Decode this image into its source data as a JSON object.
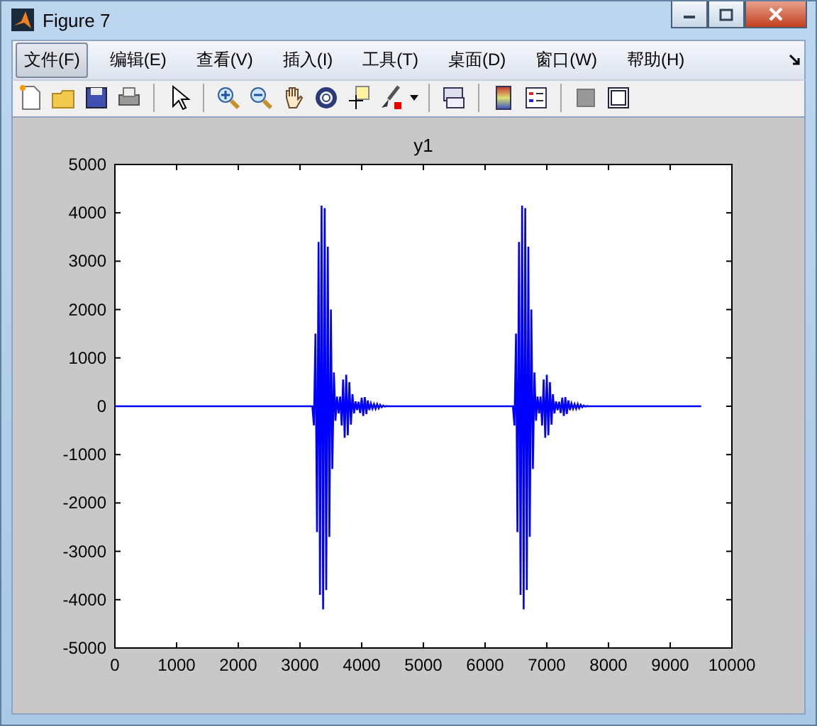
{
  "window": {
    "title": "Figure 7"
  },
  "menu": [
    {
      "label": "文件(F)",
      "selected": true
    },
    {
      "label": "编辑(E)",
      "selected": false
    },
    {
      "label": "查看(V)",
      "selected": false
    },
    {
      "label": "插入(I)",
      "selected": false
    },
    {
      "label": "工具(T)",
      "selected": false
    },
    {
      "label": "桌面(D)",
      "selected": false
    },
    {
      "label": "窗口(W)",
      "selected": false
    },
    {
      "label": "帮助(H)",
      "selected": false
    }
  ],
  "axes": {
    "chart_data": {
      "type": "line",
      "title": "y1",
      "xlim": [
        0,
        10000
      ],
      "ylim": [
        -5000,
        5000
      ],
      "xticks": [
        0,
        1000,
        2000,
        3000,
        4000,
        5000,
        6000,
        7000,
        8000,
        9000,
        10000
      ],
      "yticks": [
        -5000,
        -4000,
        -3000,
        -2000,
        -1000,
        0,
        1000,
        2000,
        3000,
        4000,
        5000
      ],
      "x": [
        0,
        3200,
        3225,
        3250,
        3275,
        3300,
        3325,
        3350,
        3375,
        3400,
        3425,
        3450,
        3475,
        3500,
        3525,
        3550,
        3575,
        3600,
        3625,
        3650,
        3675,
        3700,
        3725,
        3750,
        3775,
        3800,
        3825,
        3850,
        3875,
        3900,
        3925,
        3950,
        3975,
        4000,
        4025,
        4050,
        4075,
        4100,
        4125,
        4150,
        4175,
        4200,
        4225,
        4250,
        4275,
        4300,
        4325,
        4350,
        4375,
        4400,
        4425,
        6450,
        6475,
        6500,
        6525,
        6550,
        6575,
        6600,
        6625,
        6650,
        6675,
        6700,
        6725,
        6750,
        6775,
        6800,
        6825,
        6850,
        6875,
        6900,
        6925,
        6950,
        6975,
        7000,
        7025,
        7050,
        7075,
        7100,
        7125,
        7150,
        7175,
        7200,
        7225,
        7250,
        7275,
        7300,
        7325,
        7350,
        7375,
        7400,
        7425,
        7450,
        7475,
        7500,
        7525,
        7550,
        7575,
        7600,
        7625,
        7650,
        7675,
        9500
      ],
      "series": [
        {
          "color": "#0000ff",
          "values": [
            0,
            0,
            -400,
            1500,
            -2600,
            3400,
            -3900,
            4150,
            -4200,
            4100,
            -3800,
            3300,
            -2700,
            2000,
            -1300,
            700,
            -300,
            200,
            -150,
            200,
            -400,
            550,
            -650,
            650,
            -600,
            500,
            -380,
            250,
            -150,
            100,
            -80,
            90,
            -140,
            180,
            -200,
            190,
            -160,
            120,
            -80,
            60,
            -50,
            45,
            -50,
            45,
            -40,
            30,
            -20,
            15,
            -10,
            5,
            0,
            0,
            -400,
            1500,
            -2600,
            3400,
            -3900,
            4150,
            -4200,
            4100,
            -3800,
            3300,
            -2700,
            2000,
            -1300,
            700,
            -300,
            200,
            -150,
            200,
            -400,
            550,
            -650,
            650,
            -600,
            500,
            -380,
            250,
            -150,
            100,
            -80,
            90,
            -140,
            180,
            -200,
            190,
            -160,
            120,
            -80,
            60,
            -50,
            45,
            -50,
            45,
            -40,
            30,
            -20,
            15,
            -10,
            5,
            0,
            0
          ]
        }
      ]
    }
  }
}
